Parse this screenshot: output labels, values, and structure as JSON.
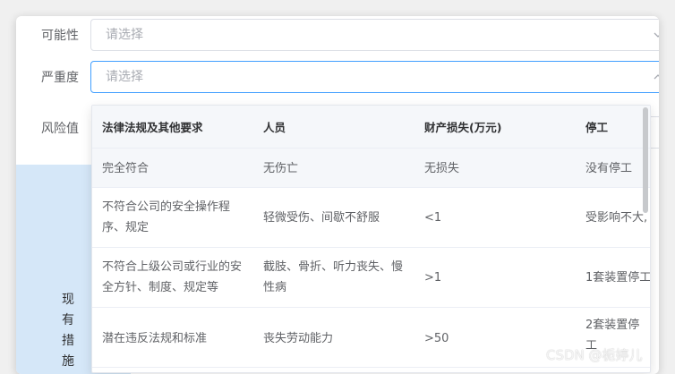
{
  "form": {
    "likelihood_label": "可能性",
    "severity_label": "严重度",
    "risk_label": "风险值",
    "placeholder": "请选择",
    "current_measures_label": [
      "现",
      "有",
      "措",
      "施"
    ]
  },
  "severity_table": {
    "columns": [
      "法律法规及其他要求",
      "人员",
      "财产损失(万元)",
      "停工"
    ],
    "rows": [
      [
        "完全符合",
        "无伤亡",
        "无损失",
        "没有停工"
      ],
      [
        "不符合公司的安全操作程序、规定",
        "轻微受伤、间歇不舒服",
        "<1",
        "受影响不大,"
      ],
      [
        "不符合上级公司或行业的安全方针、制度、规定等",
        "截肢、骨折、听力丧失、慢性病",
        ">1",
        "1套装置停工"
      ],
      [
        "潜在违反法规和标准",
        "丧失劳动能力",
        ">50",
        "2套装置停工"
      ]
    ]
  },
  "watermark": "CSDN @栀婷儿"
}
